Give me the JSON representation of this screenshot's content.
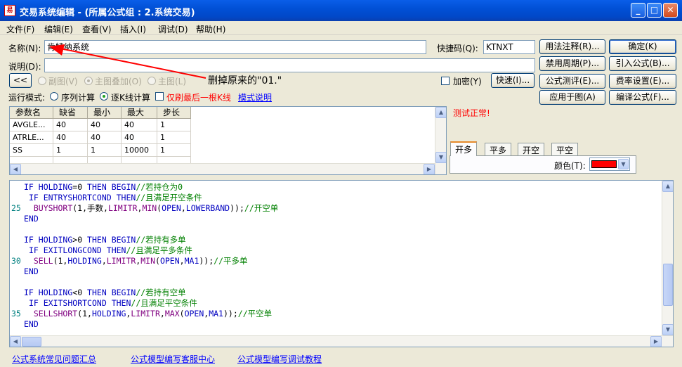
{
  "window": {
    "title": "交易系统编辑 - (所属公式组 : 2.系统交易)",
    "icon_label": "易"
  },
  "menu": [
    "文件(F)",
    "编辑(E)",
    "查看(V)",
    "插入(I)",
    "调试(D)",
    "帮助(H)"
  ],
  "form": {
    "name_label": "名称(N):",
    "name_value": "肯特纳系统",
    "code_label": "快捷码(Q):",
    "code_value": "KTNXT",
    "desc_label": "说明(D):",
    "desc_value": "",
    "collapse_btn": "<<",
    "chart_options": [
      "副图(V)",
      "主图叠加(O)",
      "主图(L)"
    ],
    "encrypt_label": "加密(Y)",
    "shortcut_btn": "快速(I)...",
    "run_mode_label": "运行模式:",
    "run_modes": [
      "序列计算",
      "逐K线计算"
    ],
    "last_bar_label": "仅刷最后一根K线",
    "mode_help_link": "模式说明",
    "annotation": "删掉原来的\"01.\""
  },
  "buttons": {
    "usage": "用法注释(R)...",
    "ok": "确定(K)",
    "disable_period": "禁用周期(P)...",
    "import": "引入公式(B)...",
    "test": "公式测评(E)...",
    "fee": "费率设置(E)...",
    "apply": "应用于图(A)",
    "compile": "编译公式(F)..."
  },
  "status": {
    "test_result": "测试正常!",
    "result_color": "#ff0000"
  },
  "params": {
    "headers": [
      "参数名",
      "缺省",
      "最小",
      "最大",
      "步长"
    ],
    "rows": [
      [
        "AVGLE...",
        "40",
        "40",
        "40",
        "1"
      ],
      [
        "ATRLE...",
        "40",
        "40",
        "40",
        "1"
      ],
      [
        "SS",
        "1",
        "1",
        "10000",
        "1"
      ]
    ]
  },
  "signal_tabs": [
    "开多",
    "平多",
    "开空",
    "平空"
  ],
  "color_label": "颜色(T):",
  "signal_color": "#ff0000",
  "code": [
    {
      "ln": "",
      "text": "IF HOLDING=0 THEN BEGIN//若持仓为0"
    },
    {
      "ln": "",
      "text": " IF ENTRYSHORTCOND THEN//且满足开空条件"
    },
    {
      "ln": "25",
      "text": "  BUYSHORT(1,手数,LIMITR,MIN(OPEN,LOWERBAND));//开空单"
    },
    {
      "ln": "",
      "text": "END"
    },
    {
      "ln": "",
      "text": ""
    },
    {
      "ln": "",
      "text": "IF HOLDING>0 THEN BEGIN//若持有多单"
    },
    {
      "ln": "",
      "text": " IF EXITLONGCOND THEN//且满足平多条件"
    },
    {
      "ln": "30",
      "text": "  SELL(1,HOLDING,LIMITR,MIN(OPEN,MA1));//平多单"
    },
    {
      "ln": "",
      "text": "END"
    },
    {
      "ln": "",
      "text": ""
    },
    {
      "ln": "",
      "text": "IF HOLDING<0 THEN BEGIN//若持有空单"
    },
    {
      "ln": "",
      "text": " IF EXITSHORTCOND THEN//且满足平空条件"
    },
    {
      "ln": "35",
      "text": "  SELLSHORT(1,HOLDING,LIMITR,MAX(OPEN,MA1));//平空单"
    },
    {
      "ln": "",
      "text": "END"
    }
  ],
  "footer_links": [
    "公式系统常见问题汇总",
    "公式模型编写客服中心",
    "公式模型编写调试教程"
  ]
}
